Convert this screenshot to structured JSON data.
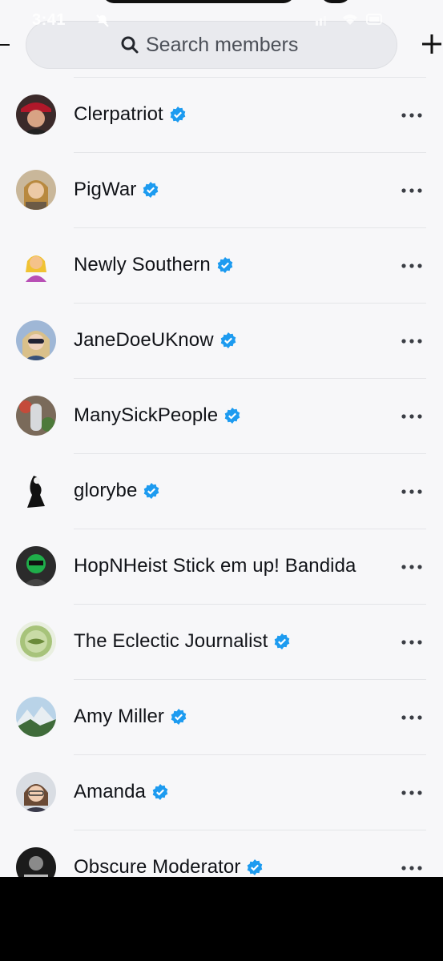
{
  "status_bar": {
    "time": "3:41"
  },
  "search": {
    "placeholder": "Search members"
  },
  "members": [
    {
      "name": "Clerpatriot",
      "verified": true
    },
    {
      "name": "PigWar",
      "verified": true
    },
    {
      "name": "Newly Southern",
      "verified": true
    },
    {
      "name": "JaneDoeUKnow",
      "verified": true
    },
    {
      "name": "ManySickPeople",
      "verified": true
    },
    {
      "name": "glorybe",
      "verified": true
    },
    {
      "name": "HopNHeist Stick em up! Bandida",
      "verified": false
    },
    {
      "name": "The Eclectic Journalist",
      "verified": true
    },
    {
      "name": "Amy Miller",
      "verified": true
    },
    {
      "name": "Amanda",
      "verified": true
    },
    {
      "name": "Obscure Moderator",
      "verified": true
    }
  ],
  "colors": {
    "verified": "#1d9bf0",
    "background": "#f7f7f9",
    "text": "#111318"
  }
}
